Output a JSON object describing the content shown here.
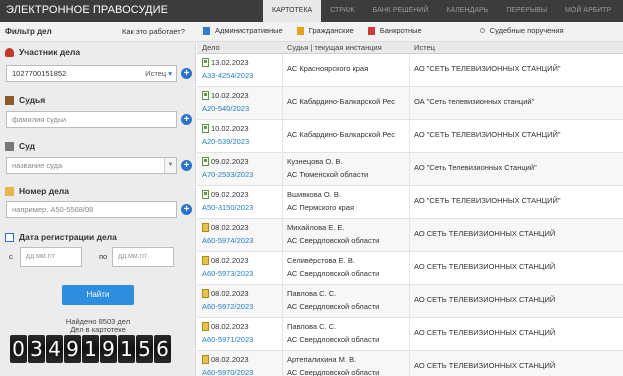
{
  "brand": "ЭЛЕКТРОННОЕ ПРАВОСУДИЕ",
  "nav": [
    "КАРТОТЕКА",
    "СТРАЖ",
    "БАНК РЕШЕНИЙ",
    "КАЛЕНДАРЬ",
    "ПЕРЕРЫВЫ",
    "МОЙ АРБИТР"
  ],
  "filter": {
    "title": "Фильтр дел",
    "how": "Как это работает?",
    "types": [
      "Административные",
      "Гражданские",
      "Банкротные",
      "Судебные поручения"
    ]
  },
  "sidebar": {
    "participant": {
      "label": "Участник дела",
      "value": "1027700151852",
      "role": "Истец"
    },
    "judge": {
      "label": "Судья",
      "placeholder": "фамилия судьи"
    },
    "court": {
      "label": "Суд",
      "placeholder": "название суда"
    },
    "case_number": {
      "label": "Номер дела",
      "placeholder": "например, А50-5568/08"
    },
    "reg_date": {
      "label": "Дата регистрации дела",
      "from": "с",
      "to": "по",
      "placeholder": "дд.мм.ггг"
    },
    "find_button": "Найти",
    "found_text": "Найдено 8503 дел",
    "cards_text": "Дел в картотеке",
    "counter": [
      "0",
      "3",
      "4",
      "9",
      "1",
      "9",
      "1",
      "5",
      "6"
    ]
  },
  "table": {
    "headers": [
      "Дело",
      "Судья | текущая инстанция",
      "Истец"
    ],
    "rows": [
      {
        "icon": "a",
        "date": "13.02.2023",
        "case": "А33-4254/2023",
        "judge": "",
        "court": "АС Красноярского края",
        "plaintiff": "АО \"СЕТЬ ТЕЛЕВИЗИОННЫХ СТАНЦИЙ\""
      },
      {
        "icon": "a",
        "date": "10.02.2023",
        "case": "А20-540/2023",
        "judge": "",
        "court": "АС Кабардино-Балкарской Рес",
        "plaintiff": "ОА \"Сеть телевизионных станций\""
      },
      {
        "icon": "a",
        "date": "10.02.2023",
        "case": "А20-539/2023",
        "judge": "",
        "court": "АС Кабардино-Балкарской Рес",
        "plaintiff": "АО \"СЕТЬ ТЕЛЕВИЗИОННЫХ СТАНЦИЙ\""
      },
      {
        "icon": "a",
        "date": "09.02.2023",
        "case": "А70-2533/2023",
        "judge": "Кузнецова О. В.",
        "court": "АС Тюменской области",
        "plaintiff": "АО \"Сеть Телевизионных Станций\""
      },
      {
        "icon": "a",
        "date": "09.02.2023",
        "case": "А50-3150/2023",
        "judge": "Вшивкова О. В.",
        "court": "АС Пермского края",
        "plaintiff": "АО \"СЕТЬ ТЕЛЕВИЗИОННЫХ СТАНЦИЙ\""
      },
      {
        "icon": "g",
        "date": "08.02.2023",
        "case": "А60-5974/2023",
        "judge": "Михайлова Е. Е.",
        "court": "АС Свердловской области",
        "plaintiff": "АО СЕТЬ ТЕЛЕВИЗИОННЫХ СТАНЦИЙ"
      },
      {
        "icon": "g",
        "date": "08.02.2023",
        "case": "А60-5973/2023",
        "judge": "Селивёрстова Е. В.",
        "court": "АС Свердловской области",
        "plaintiff": "АО СЕТЬ ТЕЛЕВИЗИОННЫХ СТАНЦИЙ"
      },
      {
        "icon": "g",
        "date": "08.02.2023",
        "case": "А60-5972/2023",
        "judge": "Павлова С. С.",
        "court": "АС Свердловской области",
        "plaintiff": "АО СЕТЬ ТЕЛЕВИЗИОННЫХ СТАНЦИЙ"
      },
      {
        "icon": "g",
        "date": "08.02.2023",
        "case": "А60-5971/2023",
        "judge": "Павлова С. С.",
        "court": "АС Свердловской области",
        "plaintiff": "АО СЕТЬ ТЕЛЕВИЗИОННЫХ СТАНЦИЙ"
      },
      {
        "icon": "g",
        "date": "08.02.2023",
        "case": "А60-5970/2023",
        "judge": "Артепалихина М. В.",
        "court": "АС Свердловской области",
        "plaintiff": "АО СЕТЬ ТЕЛЕВИЗИОННЫХ СТАНЦИЙ"
      }
    ]
  }
}
